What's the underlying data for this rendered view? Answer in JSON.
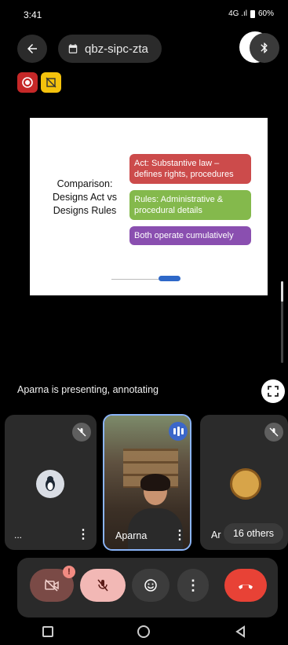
{
  "status_bar": {
    "time": "3:41",
    "icons": "4G .ıl",
    "battery": "60%"
  },
  "meeting": {
    "code": "qbz-sipc-zta"
  },
  "slide": {
    "title": "Comparison: Designs Act vs Designs Rules",
    "cards": [
      {
        "text": "Act: Substantive law – defines rights, procedures",
        "color": "#cc4b4b"
      },
      {
        "text": "Rules: Administrative & procedural details",
        "color": "#84b94c"
      },
      {
        "text": "Both operate cumulatively",
        "color": "#8a4fb0"
      }
    ]
  },
  "presentation": {
    "status_text": "Aparna is presenting, annotating"
  },
  "participants": {
    "tiles": [
      {
        "name": "..."
      },
      {
        "name": "Aparna"
      },
      {
        "name": "Ar"
      }
    ],
    "others_label": "16 others"
  },
  "colors": {
    "end_call": "#e84236",
    "mic_off_bg": "#f2b8b5",
    "cam_off_bg": "#7a4a46"
  }
}
